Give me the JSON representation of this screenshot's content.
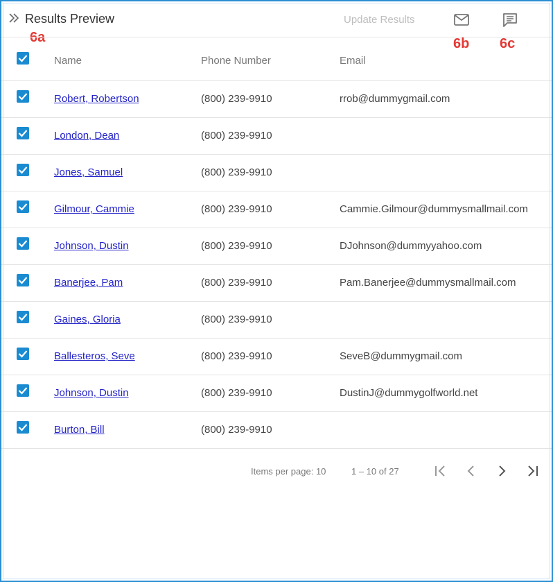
{
  "header": {
    "title": "Results Preview",
    "update_label": "Update Results"
  },
  "callouts": {
    "a": "6a",
    "b": "6b",
    "c": "6c"
  },
  "icons": {
    "collapse": "double-chevron-right-icon",
    "mail": "mail-icon",
    "chat": "chat-icon"
  },
  "columns": {
    "name": "Name",
    "phone": "Phone Number",
    "email": "Email"
  },
  "rows": [
    {
      "name": "Robert, Robertson",
      "phone": "(800) 239-9910",
      "email": "rrob@dummygmail.com",
      "checked": true
    },
    {
      "name": "London, Dean",
      "phone": "(800) 239-9910",
      "email": "",
      "checked": true
    },
    {
      "name": "Jones, Samuel",
      "phone": "(800) 239-9910",
      "email": "",
      "checked": true
    },
    {
      "name": "Gilmour, Cammie",
      "phone": "(800) 239-9910",
      "email": "Cammie.Gilmour@dummysmallmail.com",
      "checked": true
    },
    {
      "name": "Johnson, Dustin",
      "phone": "(800) 239-9910",
      "email": "DJohnson@dummyyahoo.com",
      "checked": true
    },
    {
      "name": "Banerjee, Pam",
      "phone": "(800) 239-9910",
      "email": "Pam.Banerjee@dummysmallmail.com",
      "checked": true
    },
    {
      "name": "Gaines, Gloria",
      "phone": "(800) 239-9910",
      "email": "",
      "checked": true
    },
    {
      "name": "Ballesteros, Seve",
      "phone": "(800) 239-9910",
      "email": "SeveB@dummygmail.com",
      "checked": true
    },
    {
      "name": "Johnson, Dustin",
      "phone": "(800) 239-9910",
      "email": "DustinJ@dummygolfworld.net",
      "checked": true
    },
    {
      "name": "Burton, Bill",
      "phone": "(800) 239-9910",
      "email": "",
      "checked": true
    }
  ],
  "pager": {
    "items_per_page": "Items per page: 10",
    "range": "1 – 10 of 27"
  },
  "colors": {
    "accent": "#1a8bd1",
    "link": "#2323c8",
    "callout": "#e53935",
    "frame": "#2b8fd3"
  }
}
